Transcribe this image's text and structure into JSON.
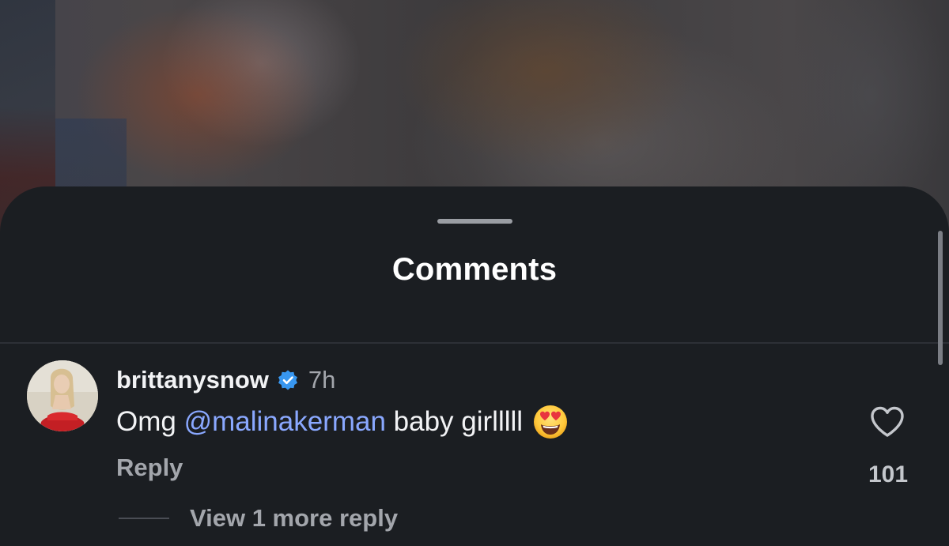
{
  "sheet": {
    "title": "Comments"
  },
  "comment": {
    "username": "brittanysnow",
    "verified": true,
    "time": "7h",
    "text_prefix": "Omg ",
    "mention": "@malinakerman",
    "text_suffix": " baby girlllll",
    "emoji": "smiling-face-with-heart-eyes",
    "reply_label": "Reply",
    "like_count": "101",
    "view_more_label": "View 1 more reply"
  },
  "colors": {
    "sheet_background": "#1b1e22",
    "mention": "#8aa8ff",
    "verified_badge": "#3897f0",
    "muted_text": "#a3a6ac"
  }
}
